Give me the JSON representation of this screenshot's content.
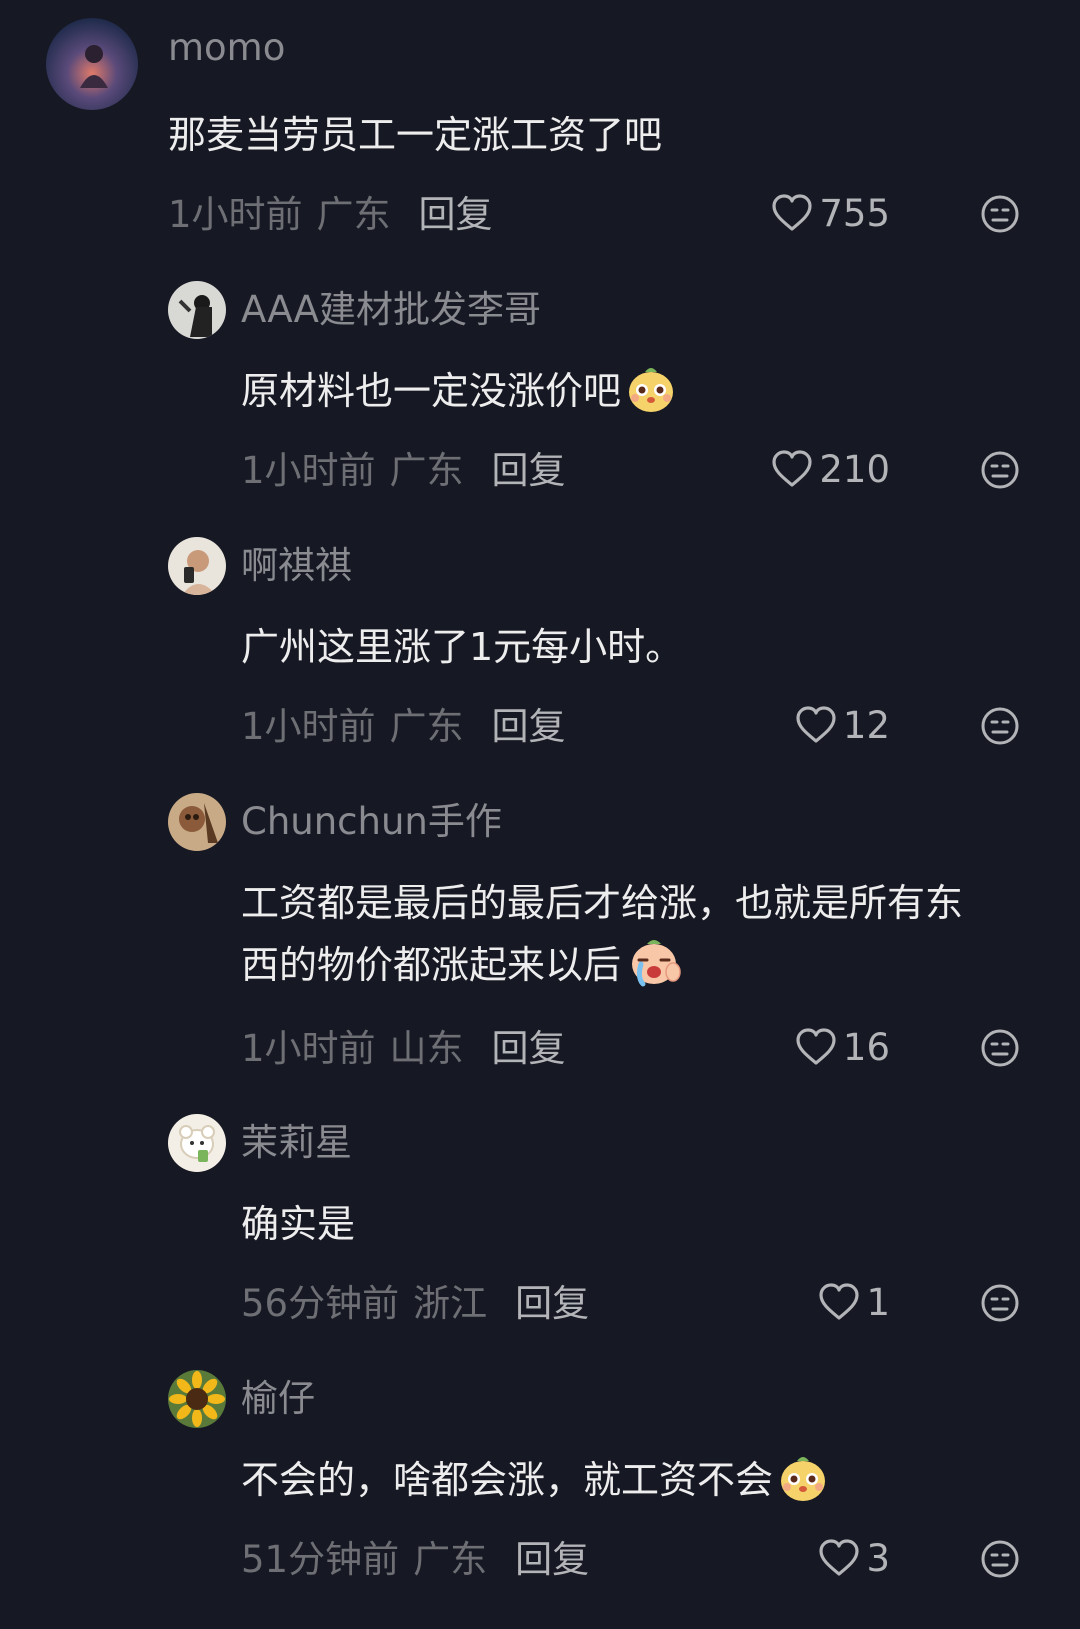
{
  "comments": [
    {
      "username": "momo",
      "text": "那麦当劳员工一定涨工资了吧",
      "time": "1小时前",
      "region": "广东",
      "reply": "回复",
      "likes": "755",
      "emoji": ""
    },
    {
      "username": "AAA建材批发李哥",
      "text": "原材料也一定没涨价吧",
      "time": "1小时前",
      "region": "广东",
      "reply": "回复",
      "likes": "210",
      "emoji": "doge-emoji"
    },
    {
      "username": "啊祺祺",
      "text": "广州这里涨了1元每小时。",
      "time": "1小时前",
      "region": "广东",
      "reply": "回复",
      "likes": "12",
      "emoji": ""
    },
    {
      "username": "Chunchun手作",
      "text_line1": "工资都是最后的最后才给涨，也就是所有东",
      "text_line2": "西的物价都涨起来以后",
      "time": "1小时前",
      "region": "山东",
      "reply": "回复",
      "likes": "16",
      "emoji": "crying-emoji"
    },
    {
      "username": "茉莉星",
      "text": "确实是",
      "time": "56分钟前",
      "region": "浙江",
      "reply": "回复",
      "likes": "1",
      "emoji": ""
    },
    {
      "username": "榆仔",
      "text": "不会的，啥都会涨，就工资不会",
      "time": "51分钟前",
      "region": "广东",
      "reply": "回复",
      "likes": "3",
      "emoji": "doge-emoji"
    }
  ],
  "colors": {
    "background": "#161823",
    "username": "#8a8b91",
    "text": "#ededee",
    "meta": "#6e6f75"
  },
  "icons": {
    "like": "heart-outline-icon",
    "dislike": "unamused-face-icon"
  }
}
